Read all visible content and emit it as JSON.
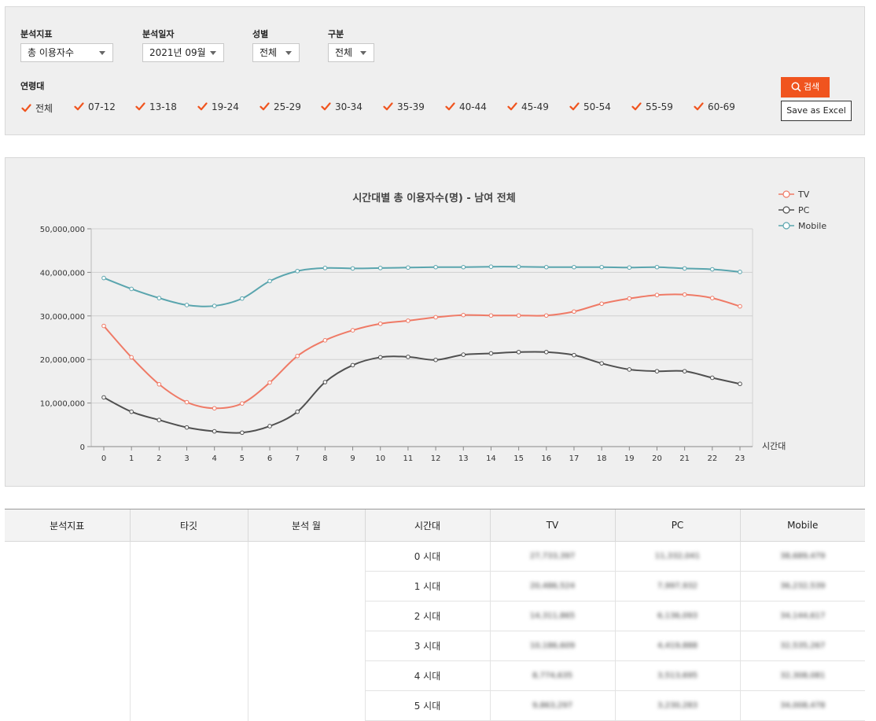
{
  "filters": {
    "metric": {
      "label": "분석지표",
      "value": "총 이용자수"
    },
    "date": {
      "label": "분석일자",
      "value": "2021년 09월"
    },
    "gender": {
      "label": "성별",
      "value": "전체"
    },
    "category": {
      "label": "구분",
      "value": "전체"
    },
    "age": {
      "label": "연령대",
      "options": [
        "전체",
        "07-12",
        "13-18",
        "19-24",
        "25-29",
        "30-34",
        "35-39",
        "40-44",
        "45-49",
        "50-54",
        "55-59",
        "60-69"
      ],
      "checked": [
        true,
        true,
        true,
        true,
        true,
        true,
        true,
        true,
        true,
        true,
        true,
        true
      ]
    }
  },
  "actions": {
    "search_label": "검색",
    "excel_label": "Save as Excel"
  },
  "colors": {
    "accent": "#f0541e",
    "tv": "#ef7a66",
    "pc": "#505050",
    "mobile": "#5aa5ae"
  },
  "chart_data": {
    "type": "line",
    "title": "시간대별  총 이용자수(명)  - 남여 전체",
    "xlabel": "시간대",
    "ylabel": "",
    "x": [
      0,
      1,
      2,
      3,
      4,
      5,
      6,
      7,
      8,
      9,
      10,
      11,
      12,
      13,
      14,
      15,
      16,
      17,
      18,
      19,
      20,
      21,
      22,
      23
    ],
    "ylim": [
      0,
      50000000
    ],
    "yticks": [
      0,
      10000000,
      20000000,
      30000000,
      40000000,
      50000000
    ],
    "ytick_labels": [
      "0",
      "10,000,000",
      "20,000,000",
      "30,000,000",
      "40,000,000",
      "50,000,000"
    ],
    "grid": true,
    "legend": "top-right",
    "series": [
      {
        "name": "TV",
        "color": "#ef7a66",
        "values": [
          27700000,
          20500000,
          14300000,
          10200000,
          8800000,
          9900000,
          14700000,
          20800000,
          24400000,
          26700000,
          28200000,
          28900000,
          29700000,
          30200000,
          30100000,
          30100000,
          30100000,
          31000000,
          32800000,
          34000000,
          34800000,
          34900000,
          34100000,
          32200000
        ]
      },
      {
        "name": "PC",
        "color": "#505050",
        "values": [
          11300000,
          8000000,
          6100000,
          4400000,
          3500000,
          3200000,
          4700000,
          8000000,
          14800000,
          18700000,
          20500000,
          20600000,
          19900000,
          21100000,
          21400000,
          21700000,
          21700000,
          21000000,
          19100000,
          17700000,
          17300000,
          17300000,
          15800000,
          14400000
        ]
      },
      {
        "name": "Mobile",
        "color": "#5aa5ae",
        "values": [
          38700000,
          36200000,
          34100000,
          32500000,
          32300000,
          34000000,
          38000000,
          40300000,
          41000000,
          40900000,
          41000000,
          41100000,
          41200000,
          41200000,
          41300000,
          41300000,
          41200000,
          41200000,
          41200000,
          41100000,
          41200000,
          40900000,
          40700000,
          40100000
        ]
      }
    ]
  },
  "table": {
    "headers": [
      "분석지표",
      "타깃",
      "분석 월",
      "시간대",
      "TV",
      "PC",
      "Mobile"
    ],
    "rows": [
      {
        "hour": "0 시대",
        "tv": "27,733,397",
        "pc": "11,332,041",
        "mobile": "38,689,479"
      },
      {
        "hour": "1 시대",
        "tv": "20,486,524",
        "pc": "7,997,932",
        "mobile": "36,232,539"
      },
      {
        "hour": "2 시대",
        "tv": "14,311,865",
        "pc": "6,136,093",
        "mobile": "34,144,617"
      },
      {
        "hour": "3 시대",
        "tv": "10,186,609",
        "pc": "4,419,888",
        "mobile": "32,535,267"
      },
      {
        "hour": "4 시대",
        "tv": "8,774,635",
        "pc": "3,513,695",
        "mobile": "32,308,081"
      },
      {
        "hour": "5 시대",
        "tv": "9,863,297",
        "pc": "3,230,283",
        "mobile": "34,008,478"
      }
    ]
  }
}
